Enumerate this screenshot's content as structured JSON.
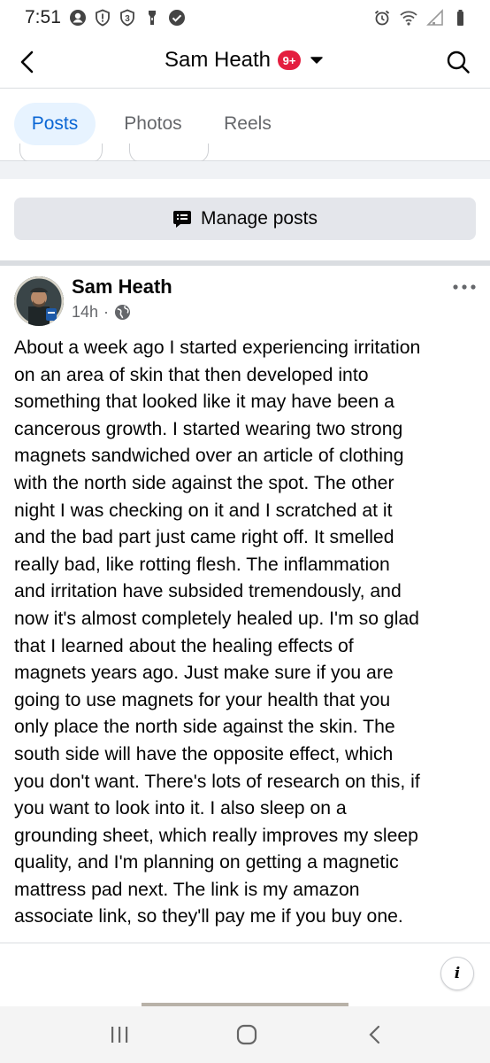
{
  "status_bar": {
    "time": "7:51",
    "left_icons": [
      "account-circle-icon",
      "shield-alert-icon",
      "badge-3-icon",
      "flashlight-icon",
      "check-circle-icon"
    ],
    "right_icons": [
      "alarm-icon",
      "wifi-icon",
      "signal-icon",
      "battery-icon"
    ]
  },
  "header": {
    "title": "Sam Heath",
    "badge": "9+",
    "badge_color": "#e41e3f"
  },
  "tabs": [
    {
      "label": "Posts",
      "active": true
    },
    {
      "label": "Photos",
      "active": false
    },
    {
      "label": "Reels",
      "active": false
    }
  ],
  "manage": {
    "label": "Manage posts"
  },
  "post": {
    "author": "Sam Heath",
    "time": "14h",
    "separator": "·",
    "audience_icon": "globe-icon",
    "lines": [
      "About a week ago I started experiencing irritation",
      "on an area of skin that then developed into",
      "something that looked like it may have been a",
      "cancerous growth. I started wearing two strong",
      "magnets sandwiched over an article of clothing",
      "with the north side against the spot. The other",
      "night I was checking on it and I scratched at it",
      "and the bad part just came right off. It smelled",
      "really bad, like rotting flesh. The inflammation",
      "and irritation have subsided tremendously, and",
      "now it's almost completely healed up. I'm so glad",
      "that I learned about the healing effects of",
      "magnets years ago. Just make sure if you are",
      "going to use magnets for your health that you",
      "only place the north side against the skin. The",
      "south side will have the opposite effect, which",
      "you don't want. There's lots of research on this, if",
      "you want to look into it. I also sleep on a",
      "grounding sheet, which really improves my sleep",
      "quality, and I'm planning on getting a magnetic",
      "mattress pad next. The link is my amazon",
      "associate link, so they'll pay me if you buy one."
    ],
    "info_glyph": "i"
  },
  "colors": {
    "accent": "#0a66d4",
    "tab_active_bg": "#e7f3ff",
    "button_bg": "#e4e6eb",
    "secondary_text": "#65676b",
    "divider": "#dadde1"
  }
}
